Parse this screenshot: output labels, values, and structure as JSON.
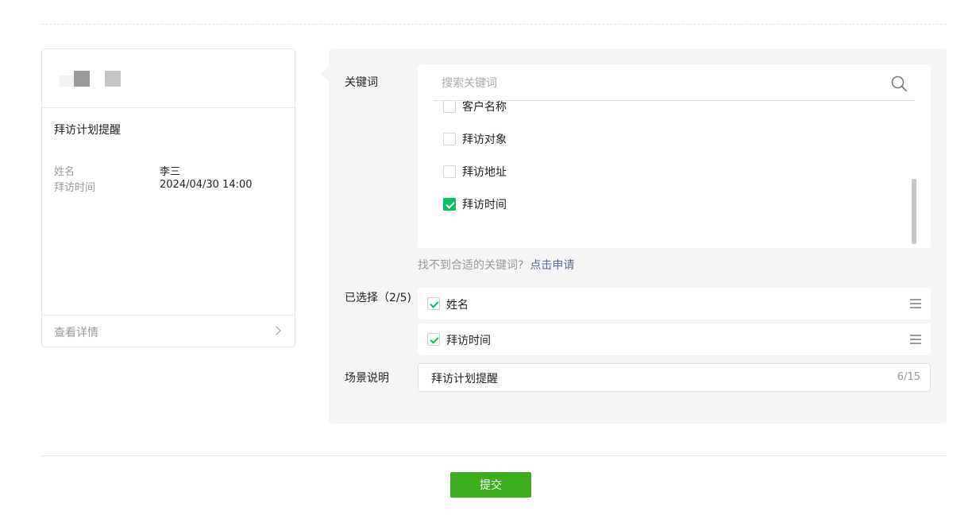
{
  "preview": {
    "title": "拜访计划提醒",
    "fields": [
      {
        "key": "姓名",
        "value": "李三"
      },
      {
        "key": "拜访时间",
        "value": "2024/04/30 14:00"
      }
    ],
    "footer_link": "查看详情"
  },
  "keywords": {
    "label": "关键词",
    "search_placeholder": "搜索关键词",
    "items": [
      {
        "label": "客户名称",
        "checked": false
      },
      {
        "label": "拜访对象",
        "checked": false
      },
      {
        "label": "拜访地址",
        "checked": false
      },
      {
        "label": "拜访时间",
        "checked": true
      }
    ],
    "hint": "找不到合适的关键词?",
    "apply_link": "点击申请"
  },
  "selected": {
    "label": "已选择（2/5)",
    "items": [
      {
        "label": "姓名"
      },
      {
        "label": "拜访时间"
      }
    ]
  },
  "scene": {
    "label": "场景说明",
    "value": "拜访计划提醒",
    "counter": "6/15"
  },
  "submit_label": "提交",
  "colors": {
    "accent_green": "#07c160",
    "submit_green": "#3bad1f",
    "link_blue": "#576b95"
  }
}
